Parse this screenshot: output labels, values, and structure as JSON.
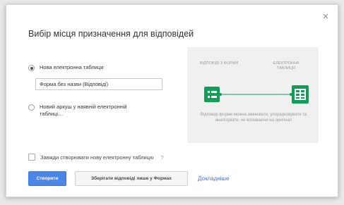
{
  "dialog": {
    "title": "Вибір місця призначення для відповідей",
    "close_symbol": "×",
    "option_new_label": "Нова електронна таблиця",
    "name_input_value": "Форма без назви (Відповіді)",
    "option_existing_label_line1": "Новий аркуш у наявній електронній",
    "option_existing_label_line2": "таблиці…",
    "always_create_label": "Завжди створювати нову електронну таблицю",
    "help_symbol": "?",
    "create_button": "Створити",
    "keep_in_forms_button": "Зберігати відповіді лише у Формах",
    "more_link": "Докладніше"
  },
  "diagram": {
    "left_label": "Відповіді з форми",
    "right_label_line1": "Електронна",
    "right_label_line2": "таблиця",
    "description": "Відповіді форми можна змінювати, упорядковувати та аналізувати, не впливаючи на оригінал",
    "forms_icon": "google-forms-icon",
    "sheets_icon": "google-sheets-icon",
    "accent_color": "#0f9d58"
  }
}
